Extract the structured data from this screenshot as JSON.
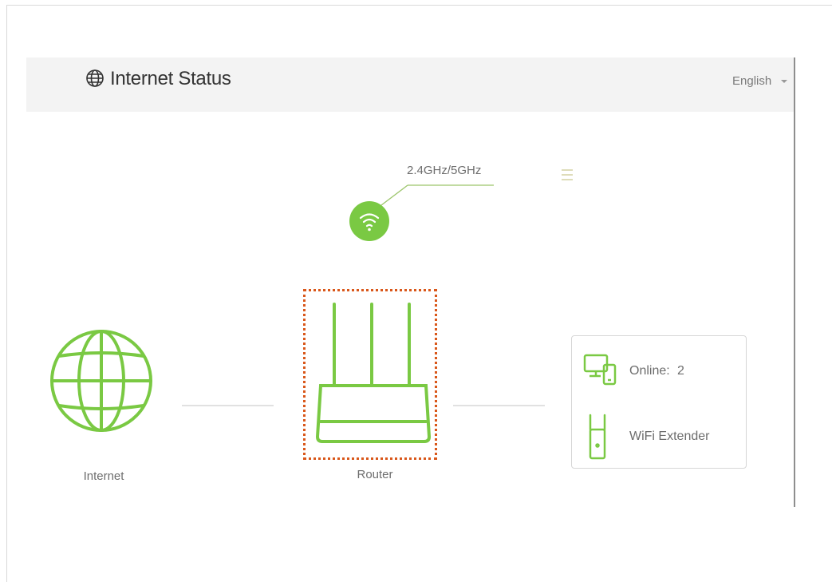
{
  "header": {
    "icon": "globe-icon",
    "title": "Internet Status",
    "language": "English"
  },
  "wireless": {
    "band_label": "2.4GHz/5GHz",
    "icon": "wifi-icon",
    "color": "#7ac943"
  },
  "topology": {
    "internet_label": "Internet",
    "router_label": "Router",
    "accent_color": "#7ac943",
    "highlight_color": "#d9571a"
  },
  "devices": {
    "online_label": "Online:",
    "online_count": "2",
    "extender_label": "WiFi Extender"
  }
}
